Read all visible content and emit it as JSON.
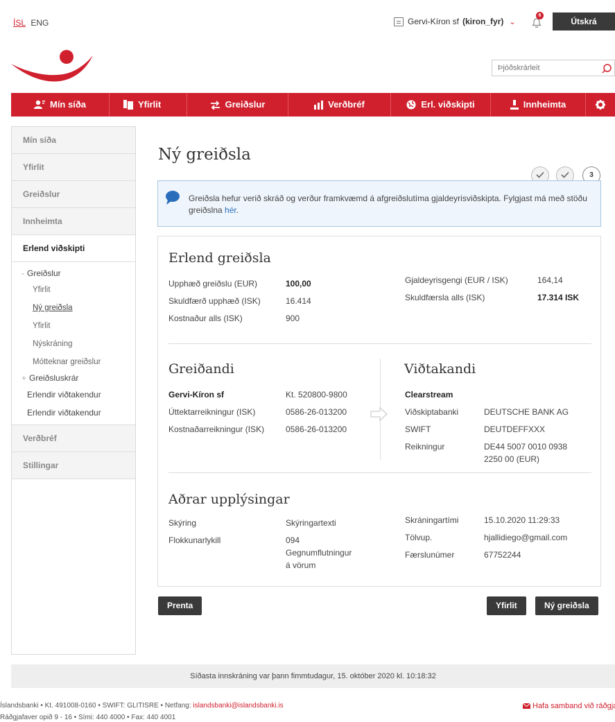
{
  "topbar": {
    "lang_isl": "ÍSL",
    "lang_eng": "ENG",
    "account_name": "Gervi-Kíron sf",
    "account_user": "(kiron_fyr)",
    "notification_count": "6",
    "logout_label": "Útskrá"
  },
  "search": {
    "placeholder": "Þjóðskrárleit"
  },
  "nav": [
    {
      "label": "Mín síða",
      "icon": "user-icon"
    },
    {
      "label": "Yfirlit",
      "icon": "documents-icon"
    },
    {
      "label": "Greiðslur",
      "icon": "transfer-arrows-icon"
    },
    {
      "label": "Verðbréf",
      "icon": "bar-chart-icon"
    },
    {
      "label": "Erl. viðskipti",
      "icon": "globe-icon"
    },
    {
      "label": "Innheimta",
      "icon": "person-down-icon"
    },
    {
      "label": "",
      "icon": "gear-icon"
    }
  ],
  "sidebar": {
    "top_items": [
      "Mín síða",
      "Yfirlit",
      "Greiðslur",
      "Innheimta"
    ],
    "active": "Erlend viðskipti",
    "sub": {
      "greidslur": "Greiðslur",
      "yfirlit1": "Yfirlit",
      "ny_greidsla": "Ný greiðsla",
      "yfirlit2": "Yfirlit",
      "nyskraning": "Nýskráning",
      "mottekknar": "Mótteknar greiðslur",
      "greidsluskrar": "Greiðsluskrár",
      "erl_vidtakendur1": "Erlendir viðtakendur",
      "erl_vidtakendur2": "Erlendir viðtakendur"
    },
    "bottom_items": [
      "Verðbréf",
      "Stillingar"
    ]
  },
  "page": {
    "title": "Ný greiðsla",
    "step_current": "3",
    "info_text": "Greiðsla hefur verið skráð og verður framkvæmd á afgreiðslutíma gjaldeyrisviðskipta. Fylgjast má með stöðu greiðslna ",
    "info_link": "hér",
    "info_end": "."
  },
  "erlend": {
    "title": "Erlend greiðsla",
    "upphaed_label": "Upphæð greiðslu (EUR)",
    "upphaed_value": "100,00",
    "skuldfaerd_label": "Skuldfærð upphæð (ISK)",
    "skuldfaerd_value": "16.414",
    "kostnadur_label": "Kostnaður alls (ISK)",
    "kostnadur_value": "900",
    "gengi_label": "Gjaldeyrisgengi (EUR / ISK)",
    "gengi_value": "164,14",
    "skuldfaersla_label": "Skuldfærsla alls (ISK)",
    "skuldfaersla_value": "17.314 ISK"
  },
  "greidandi": {
    "title": "Greiðandi",
    "name": "Gervi-Kíron sf",
    "kt": "Kt. 520800-9800",
    "uttekt_label": "Úttektarreikningur (ISK)",
    "uttekt_value": "0586-26-013200",
    "kostn_label": "Kostnaðarreikningur (ISK)",
    "kostn_value": "0586-26-013200"
  },
  "vidtakandi": {
    "title": "Viðtakandi",
    "name": "Clearstream",
    "banki_label": "Viðskiptabanki",
    "banki_value": "DEUTSCHE BANK AG",
    "swift_label": "SWIFT",
    "swift_value": "DEUTDEFFXXX",
    "reikn_label": "Reikningur",
    "reikn_value1": "DE44 5007 0010 0938",
    "reikn_value2": "2250 00 (EUR)"
  },
  "adrar": {
    "title": "Aðrar upplýsingar",
    "skyring_label": "Skýring",
    "skyring_value": "Skýringartexti",
    "flokk_label": "Flokkunarlykill",
    "flokk_value1": "094",
    "flokk_value2": "Gegnumflutningur",
    "flokk_value3": "á vörum",
    "skran_label": "Skráningartími",
    "skran_value": "15.10.2020 11:29:33",
    "tolvup_label": "Tölvup.",
    "tolvup_value": "hjallidiego@gmail.com",
    "faersl_label": "Færslunúmer",
    "faersl_value": "67752244"
  },
  "buttons": {
    "print": "Prenta",
    "overview": "Yfirlit",
    "new_payment": "Ný greiðsla"
  },
  "footer": {
    "last_login": "Síðasta innskráning var þann fimmtudagur, 15. október 2020 kl. 10:18:32",
    "line1": "Íslandsbanki • Kt. 491008-0160 • SWIFT: GLITISRE • Netfang: ",
    "email": "islandsbanki@islandsbanki.is",
    "line2": "Ráðgjafaver opið 9 - 16 • Sími: 440 4000 • Fax: 440 4001",
    "contact": "Hafa samband við ráðgja"
  },
  "colors": {
    "brand": "#d0202e",
    "dark_button": "#3a3a3a",
    "info_bg": "#eef5fc",
    "link_blue": "#2a6ebb"
  }
}
